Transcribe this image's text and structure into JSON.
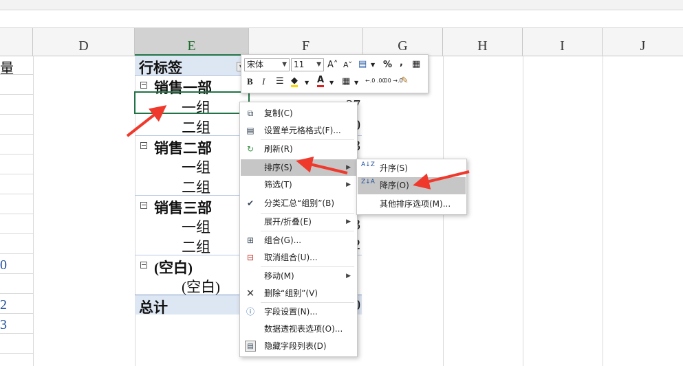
{
  "columns": {
    "d": "D",
    "e": "E",
    "f": "F",
    "g": "G",
    "h": "H",
    "i": "I",
    "j": "J"
  },
  "left_column": {
    "header_fragment": "量",
    "num_fragments": [
      "0",
      "2",
      "3"
    ]
  },
  "pivot": {
    "header": "行标签",
    "rows": [
      {
        "label": "销售一部",
        "value": ""
      },
      {
        "label": "一组",
        "value": "27"
      },
      {
        "label": "二组",
        "value": "0"
      },
      {
        "label": "销售二部",
        "value": "3"
      },
      {
        "label": "一组",
        "value": ""
      },
      {
        "label": "二组",
        "value": ""
      },
      {
        "label": "销售三部",
        "value": ""
      },
      {
        "label": "一组",
        "value": "3"
      },
      {
        "label": "二组",
        "value": "2"
      },
      {
        "label": "(空白)",
        "value": ""
      },
      {
        "label": "(空白)",
        "value": ""
      }
    ],
    "total_label": "总计",
    "total_value": "0"
  },
  "mini_toolbar": {
    "font_name": "宋体",
    "font_size": "11",
    "grow_font": "A˄",
    "shrink_font": "A˅",
    "percent": "%",
    "comma": ",",
    "bold": "B",
    "italic": "I",
    "font_color_letter": "A",
    "dec_increase": "←.0 .00",
    "dec_decrease": ".00 →.0"
  },
  "context_menu": {
    "copy": "复制(C)",
    "format_cells": "设置单元格格式(F)...",
    "refresh": "刷新(R)",
    "sort": "排序(S)",
    "filter": "筛选(T)",
    "subtotal": "分类汇总“组别”(B)",
    "expand_collapse": "展开/折叠(E)",
    "group": "组合(G)...",
    "ungroup": "取消组合(U)...",
    "move": "移动(M)",
    "remove": "删除“组别”(V)",
    "field_settings": "字段设置(N)...",
    "pivot_options": "数据透视表选项(O)...",
    "hide_field_list": "隐藏字段列表(D)"
  },
  "sort_submenu": {
    "asc": "升序(S)",
    "desc": "降序(O)",
    "more": "其他排序选项(M)..."
  },
  "colors": {
    "selection_green": "#217346",
    "pivot_header_bg": "#dde6f3",
    "menu_highlight": "#c6c6c6",
    "annotation_arrow": "#f0392d"
  },
  "icons": {
    "check": "✔",
    "submenu_arrow": "▶",
    "sort_asc": "A↓Z",
    "sort_desc": "Z↓A"
  }
}
